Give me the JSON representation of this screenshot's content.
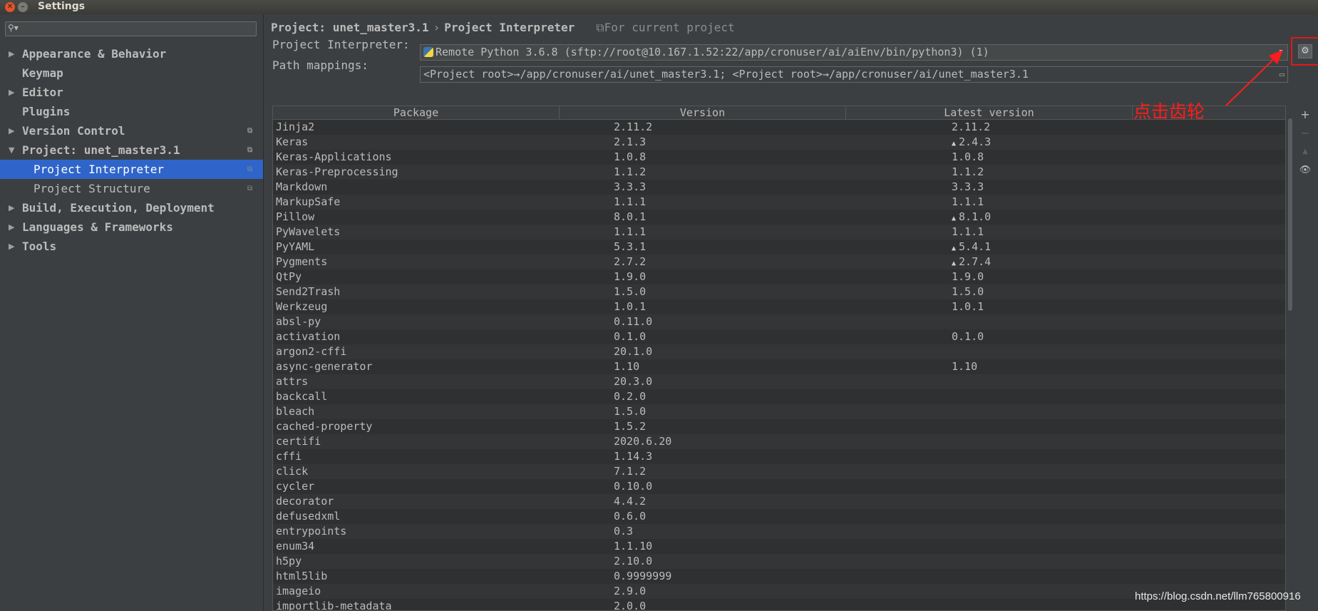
{
  "window": {
    "title": "Settings"
  },
  "search": {
    "icon": "search-icon"
  },
  "sidebar": {
    "items": [
      {
        "label": "Appearance & Behavior",
        "arrow": "▶",
        "indent": 0,
        "bold": true,
        "selected": false,
        "cfg": ""
      },
      {
        "label": "Keymap",
        "arrow": "",
        "indent": 0,
        "bold": true,
        "selected": false,
        "cfg": ""
      },
      {
        "label": "Editor",
        "arrow": "▶",
        "indent": 0,
        "bold": true,
        "selected": false,
        "cfg": ""
      },
      {
        "label": "Plugins",
        "arrow": "",
        "indent": 0,
        "bold": true,
        "selected": false,
        "cfg": ""
      },
      {
        "label": "Version Control",
        "arrow": "▶",
        "indent": 0,
        "bold": true,
        "selected": false,
        "cfg": "⧉"
      },
      {
        "label": "Project: unet_master3.1",
        "arrow": "▼",
        "indent": 0,
        "bold": true,
        "selected": false,
        "cfg": "⧉"
      },
      {
        "label": "Project Interpreter",
        "arrow": "",
        "indent": 1,
        "bold": false,
        "selected": true,
        "cfg": "⧉"
      },
      {
        "label": "Project Structure",
        "arrow": "",
        "indent": 1,
        "bold": false,
        "selected": false,
        "cfg": "⧉"
      },
      {
        "label": "Build, Execution, Deployment",
        "arrow": "▶",
        "indent": 0,
        "bold": true,
        "selected": false,
        "cfg": ""
      },
      {
        "label": "Languages & Frameworks",
        "arrow": "▶",
        "indent": 0,
        "bold": true,
        "selected": false,
        "cfg": ""
      },
      {
        "label": "Tools",
        "arrow": "▶",
        "indent": 0,
        "bold": true,
        "selected": false,
        "cfg": ""
      }
    ]
  },
  "breadcrumb": {
    "project": "Project: unet_master3.1",
    "separator": "›",
    "page": "Project Interpreter",
    "scope": "⧉For current project"
  },
  "interpreter": {
    "label": "Project Interpreter:",
    "value": "Remote Python 3.6.8 (sftp://root@10.167.1.52:22/app/cronuser/ai/aiEnv/bin/python3) (1)"
  },
  "path_mappings": {
    "label": "Path mappings:",
    "value": "<Project root>→/app/cronuser/ai/unet_master3.1; <Project root>→/app/cronuser/ai/unet_master3.1"
  },
  "table": {
    "headers": [
      "Package",
      "Version",
      "Latest version"
    ],
    "rows": [
      [
        "Jinja2",
        "2.11.2",
        "2.11.2",
        false
      ],
      [
        "Keras",
        "2.1.3",
        "2.4.3",
        true
      ],
      [
        "Keras-Applications",
        "1.0.8",
        "1.0.8",
        false
      ],
      [
        "Keras-Preprocessing",
        "1.1.2",
        "1.1.2",
        false
      ],
      [
        "Markdown",
        "3.3.3",
        "3.3.3",
        false
      ],
      [
        "MarkupSafe",
        "1.1.1",
        "1.1.1",
        false
      ],
      [
        "Pillow",
        "8.0.1",
        "8.1.0",
        true
      ],
      [
        "PyWavelets",
        "1.1.1",
        "1.1.1",
        false
      ],
      [
        "PyYAML",
        "5.3.1",
        "5.4.1",
        true
      ],
      [
        "Pygments",
        "2.7.2",
        "2.7.4",
        true
      ],
      [
        "QtPy",
        "1.9.0",
        "1.9.0",
        false
      ],
      [
        "Send2Trash",
        "1.5.0",
        "1.5.0",
        false
      ],
      [
        "Werkzeug",
        "1.0.1",
        "1.0.1",
        false
      ],
      [
        "absl-py",
        "0.11.0",
        "",
        false
      ],
      [
        "activation",
        "0.1.0",
        "0.1.0",
        false
      ],
      [
        "argon2-cffi",
        "20.1.0",
        "",
        false
      ],
      [
        "async-generator",
        "1.10",
        "1.10",
        false
      ],
      [
        "attrs",
        "20.3.0",
        "",
        false
      ],
      [
        "backcall",
        "0.2.0",
        "",
        false
      ],
      [
        "bleach",
        "1.5.0",
        "",
        false
      ],
      [
        "cached-property",
        "1.5.2",
        "",
        false
      ],
      [
        "certifi",
        "2020.6.20",
        "",
        false
      ],
      [
        "cffi",
        "1.14.3",
        "",
        false
      ],
      [
        "click",
        "7.1.2",
        "",
        false
      ],
      [
        "cycler",
        "0.10.0",
        "",
        false
      ],
      [
        "decorator",
        "4.4.2",
        "",
        false
      ],
      [
        "defusedxml",
        "0.6.0",
        "",
        false
      ],
      [
        "entrypoints",
        "0.3",
        "",
        false
      ],
      [
        "enum34",
        "1.1.10",
        "",
        false
      ],
      [
        "h5py",
        "2.10.0",
        "",
        false
      ],
      [
        "html5lib",
        "0.9999999",
        "",
        false
      ],
      [
        "imageio",
        "2.9.0",
        "",
        false
      ],
      [
        "importlib-metadata",
        "2.0.0",
        "",
        false
      ]
    ],
    "upgrade_glyph": "▲"
  },
  "tools": {
    "add": "+",
    "remove": "−",
    "upgrade": "▲",
    "show": "👁"
  },
  "annotation": {
    "text": "点击齿轮",
    "color": "#ff1c1c"
  },
  "watermark": "https://blog.csdn.net/llm765800916",
  "colors": {
    "selection": "#2f65ca",
    "annotation": "#e0191b",
    "background": "#3c3f41"
  }
}
